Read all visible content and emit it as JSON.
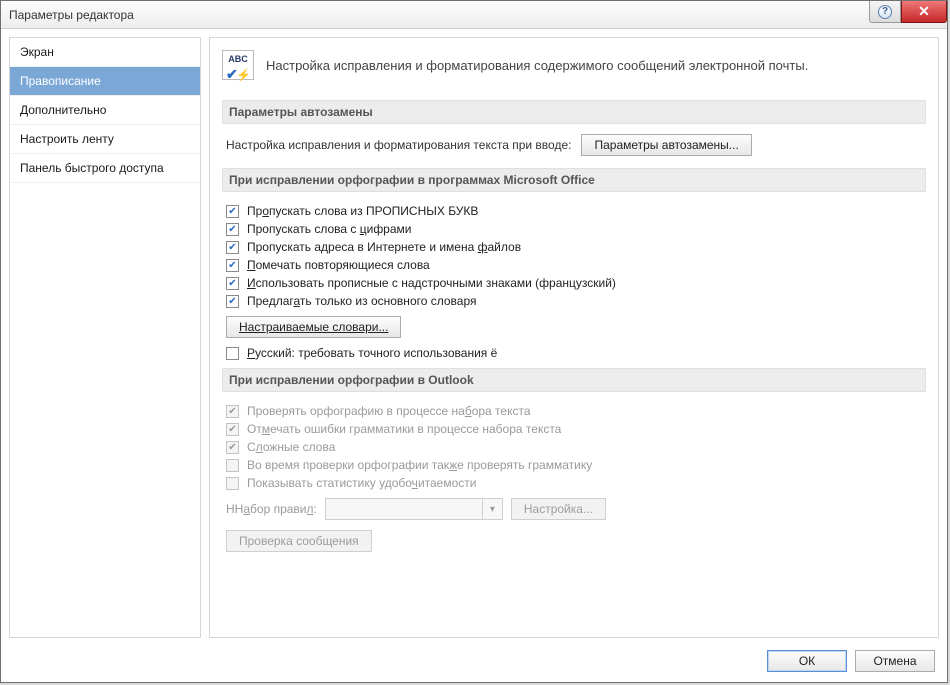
{
  "window": {
    "title": "Параметры редактора"
  },
  "sidebar": {
    "items": [
      {
        "label": "Экран"
      },
      {
        "label": "Правописание",
        "selected": true
      },
      {
        "label": "Дополнительно"
      },
      {
        "label": "Настроить ленту"
      },
      {
        "label": "Панель быстрого доступа"
      }
    ]
  },
  "intro": {
    "icon_text": "ABC",
    "text": "Настройка исправления и форматирования содержимого сообщений электронной почты."
  },
  "sections": {
    "autocorrect": {
      "title": "Параметры автозамены",
      "line_label": "Настройка исправления и форматирования текста при вводе:",
      "button": "Параметры автозамены..."
    },
    "office_spell": {
      "title": "При исправлении орфографии в программах Microsoft Office",
      "checks": [
        {
          "pre": "Пр",
          "u": "о",
          "post": "пускать слова из ПРОПИСНЫХ БУКВ",
          "checked": true
        },
        {
          "pre": "Пропускать слова с ",
          "u": "ц",
          "post": "ифрами",
          "checked": true
        },
        {
          "pre": "Пропускать адреса в Интернете и имена ",
          "u": "ф",
          "post": "айлов",
          "checked": true
        },
        {
          "pre": "",
          "u": "П",
          "post": "омечать повторяющиеся слова",
          "checked": true
        },
        {
          "pre": "",
          "u": "И",
          "post": "спользовать прописные с надстрочными знаками (французский)",
          "checked": true
        },
        {
          "pre": "Предлаг",
          "u": "а",
          "post": "ть только из основного словаря",
          "checked": true
        }
      ],
      "dict_button": "Настраиваемые словари...",
      "russian_yo": {
        "pre": "",
        "u": "Р",
        "post": "усский: требовать точного использования ё",
        "checked": false
      }
    },
    "outlook_spell": {
      "title": "При исправлении орфографии в Outlook",
      "checks": [
        {
          "pre": "Проверять орфографию в процессе на",
          "u": "б",
          "post": "ора текста",
          "checked": true,
          "disabled": true
        },
        {
          "pre": "От",
          "u": "м",
          "post": "ечать ошибки грамматики в процессе набора текста",
          "checked": true,
          "disabled": true
        },
        {
          "pre": "С",
          "u": "л",
          "post": "ожные слова",
          "checked": true,
          "disabled": true
        },
        {
          "pre": "Во время проверки орфографии так",
          "u": "ж",
          "post": "е проверять грамматику",
          "checked": false,
          "disabled": true
        },
        {
          "pre": "Показывать статистику удобо",
          "u": "ч",
          "post": "итаемости",
          "checked": false,
          "disabled": true
        }
      ],
      "rules_label": "Набор правил:",
      "settings_button": "Настройка...",
      "recheck_button": "Проверка сообщения"
    }
  },
  "footer": {
    "ok": "ОК",
    "cancel": "Отмена"
  }
}
